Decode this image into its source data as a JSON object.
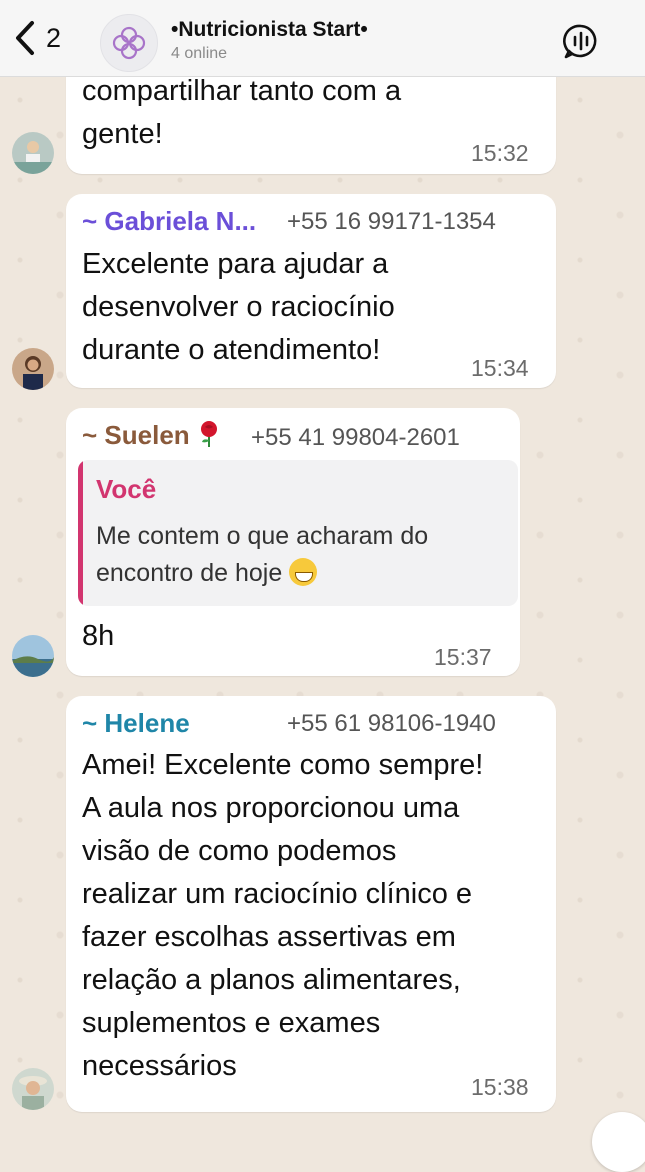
{
  "header": {
    "back_count": "2",
    "title": "•Nutricionista Start•",
    "subtitle": "4 online"
  },
  "colors": {
    "gabriela": "#6b4fd8",
    "suelen": "#8a5a3b",
    "helene": "#1f86a8",
    "quote_accent": "#d2356f"
  },
  "messages": [
    {
      "lines": [
        "compartilhar tanto com a",
        "gente!"
      ],
      "time": "15:32"
    },
    {
      "sender": "~ Gabriela N...",
      "phone": "+55 16 99171-1354",
      "lines": [
        "Excelente para ajudar a",
        "desenvolver o raciocínio",
        "durante o atendimento!"
      ],
      "time": "15:34"
    },
    {
      "sender": "~ Suelen",
      "sender_emoji": "rose-emoji",
      "phone": "+55 41 99804-2601",
      "quote": {
        "author": "Você",
        "lines": [
          "Me contem o que acharam do",
          "encontro de hoje"
        ],
        "emoji": "grinning-emoji"
      },
      "lines": [
        "8h"
      ],
      "time": "15:37"
    },
    {
      "sender": "~ Helene",
      "phone": "+55 61 98106-1940",
      "lines": [
        "Amei! Excelente como sempre!",
        "A aula nos proporcionou uma",
        "visão de como podemos",
        "realizar um raciocínio clínico e",
        "fazer escolhas assertivas em",
        "relação a planos alimentares,",
        "suplementos e exames",
        "necessários"
      ],
      "time": "15:38"
    }
  ]
}
